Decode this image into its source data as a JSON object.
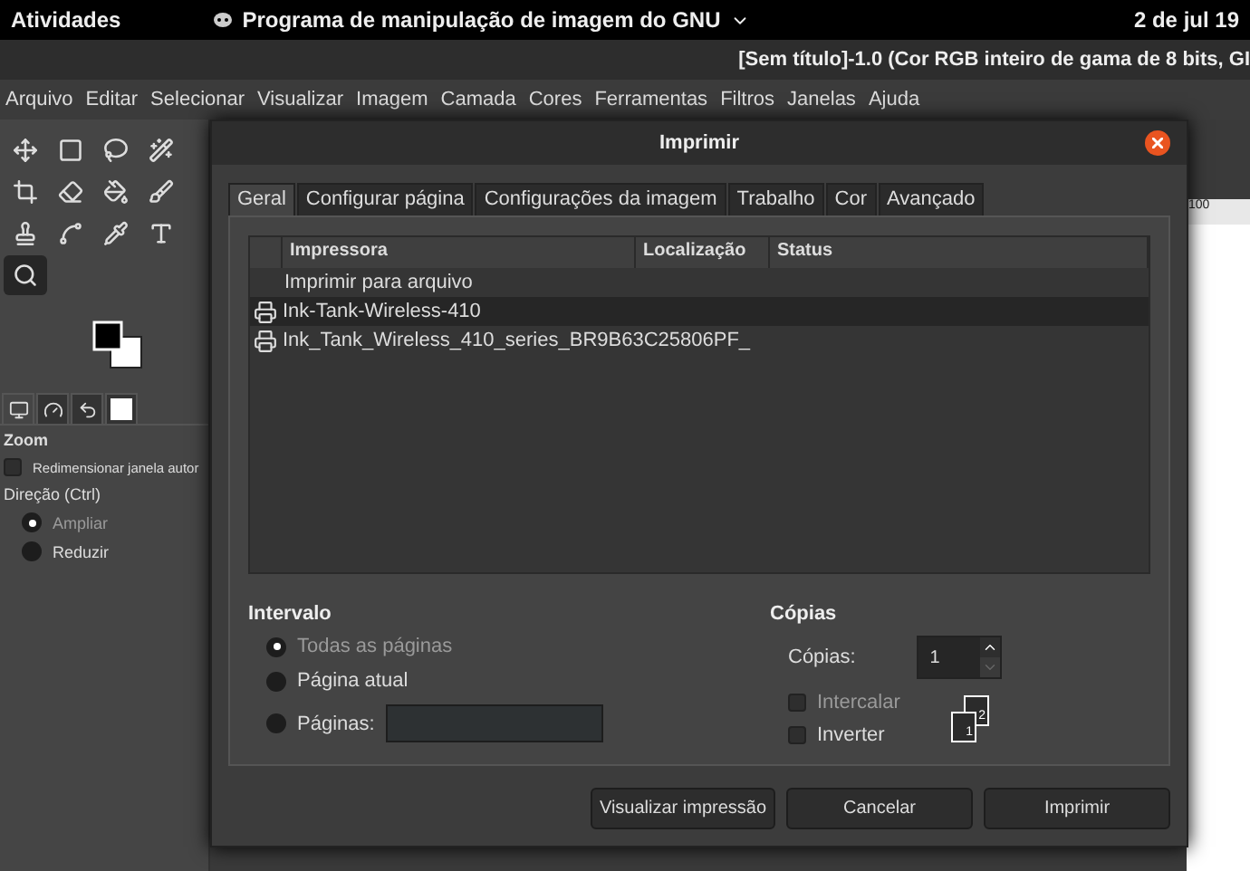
{
  "top_bar": {
    "activities": "Atividades",
    "app_menu": "Programa de manipulação de imagem do GNU",
    "clock": "2 de jul  19"
  },
  "image_window": {
    "title": "[Sem título]-1.0 (Cor RGB inteiro de gama de 8 bits, GI",
    "menu": [
      "Arquivo",
      "Editar",
      "Selecionar",
      "Visualizar",
      "Imagem",
      "Camada",
      "Cores",
      "Ferramentas",
      "Filtros",
      "Janelas",
      "Ajuda"
    ],
    "ruler_label": "100"
  },
  "toolbox": {
    "tools": [
      {
        "kind": "move",
        "selected": false
      },
      {
        "kind": "rect",
        "selected": false
      },
      {
        "kind": "lasso",
        "selected": false
      },
      {
        "kind": "wand",
        "selected": false
      },
      {
        "kind": "crop",
        "selected": false
      },
      {
        "kind": "smudge",
        "selected": false
      },
      {
        "kind": "bucket",
        "selected": false
      },
      {
        "kind": "brush",
        "selected": false
      },
      {
        "kind": "stamp",
        "selected": false
      },
      {
        "kind": "path",
        "selected": false
      },
      {
        "kind": "picker",
        "selected": false
      },
      {
        "kind": "text",
        "selected": false
      },
      {
        "kind": "zoom",
        "selected": true
      }
    ],
    "dock_tabs": [
      {
        "kind": "options",
        "selected": true
      },
      {
        "kind": "device",
        "selected": false
      },
      {
        "kind": "undo",
        "selected": false
      },
      {
        "kind": "image",
        "selected": false
      }
    ],
    "tool_options": {
      "title": "Zoom",
      "resize_window": {
        "label": "Redimensionar janela autor",
        "checked": false
      },
      "direction_label": "Direção (Ctrl)",
      "directions": [
        {
          "label": "Ampliar",
          "selected": true
        },
        {
          "label": "Reduzir",
          "selected": false
        }
      ]
    }
  },
  "dialog": {
    "title": "Imprimir",
    "tabs": [
      {
        "label": "Geral",
        "selected": true
      },
      {
        "label": "Configurar página",
        "selected": false
      },
      {
        "label": "Configurações da imagem",
        "selected": false
      },
      {
        "label": "Trabalho",
        "selected": false
      },
      {
        "label": "Cor",
        "selected": false
      },
      {
        "label": "Avançado",
        "selected": false
      }
    ],
    "printer_table": {
      "columns": [
        "Impressora",
        "Localização",
        "Status"
      ],
      "rows": [
        {
          "name": "Imprimir para arquivo",
          "kind": "file",
          "selected": false
        },
        {
          "name": "Ink-Tank-Wireless-410",
          "kind": "printer",
          "selected": true
        },
        {
          "name": "Ink_Tank_Wireless_410_series_BR9B63C25806PF_",
          "kind": "printer",
          "selected": false
        }
      ]
    },
    "range": {
      "title": "Intervalo",
      "options": [
        {
          "label": "Todas as páginas",
          "kind": "plain",
          "selected": true
        },
        {
          "label": "Página atual",
          "kind": "plain",
          "selected": false
        },
        {
          "label": "Páginas:",
          "kind": "field",
          "selected": false
        }
      ]
    },
    "copies": {
      "title": "Cópias",
      "label": "Cópias:",
      "value": "1",
      "options": [
        {
          "label": "Intercalar",
          "checked": false,
          "disabled": true
        },
        {
          "label": "Inverter",
          "checked": false,
          "disabled": false
        }
      ],
      "page_numbers": [
        "2",
        "1"
      ]
    },
    "buttons": [
      "Visualizar impressão",
      "Cancelar",
      "Imprimir"
    ]
  }
}
